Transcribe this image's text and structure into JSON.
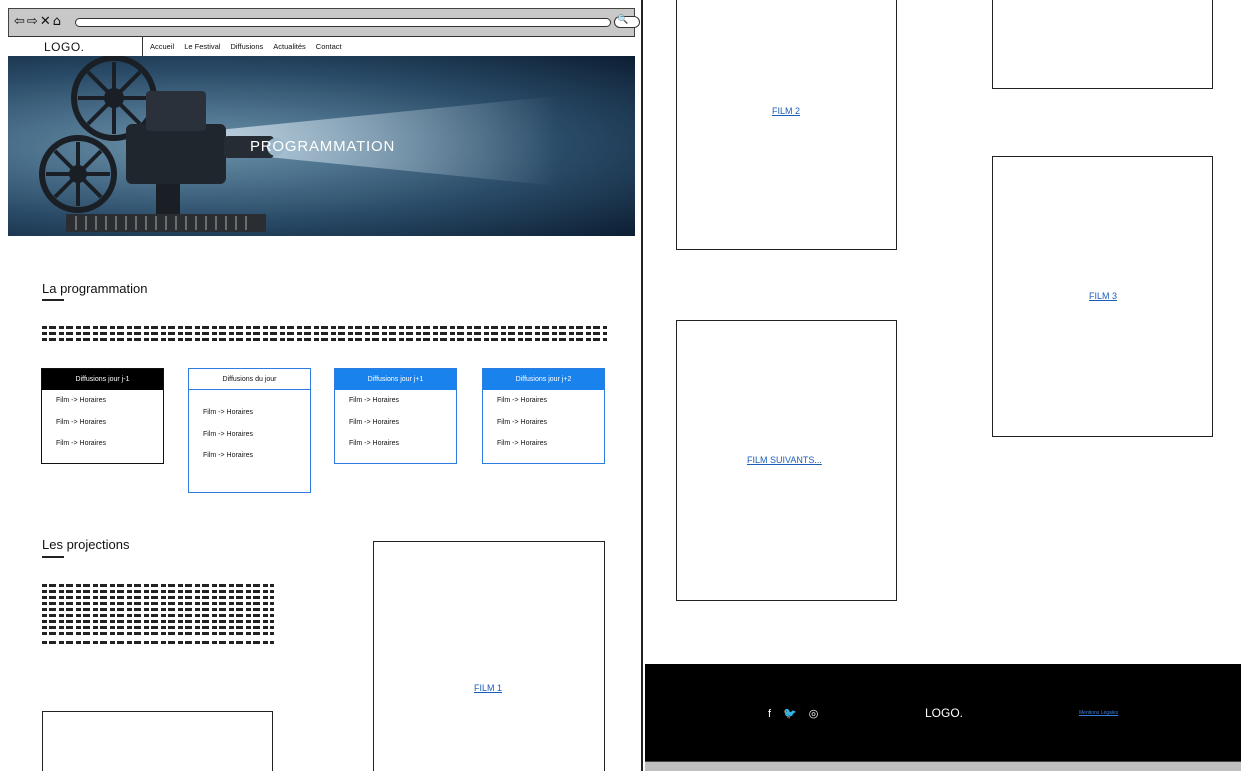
{
  "browser": {
    "nav_icons": [
      "⇦",
      "⇨",
      "✕",
      "⌂"
    ],
    "search_glyph": "🔍"
  },
  "header": {
    "logo": "LOGO.",
    "menu": [
      "Accueil",
      "Le Festival",
      "Diffusions",
      "Actualités",
      "Contact"
    ]
  },
  "hero": {
    "title": "PROGRAMMATION"
  },
  "programmation": {
    "title": "La programmation",
    "boxes": [
      {
        "header": "Diffusions jour j-1",
        "style": "dark",
        "items": [
          "Film -> Horaires",
          "Film -> Horaires",
          "Film -> Horaires"
        ]
      },
      {
        "header": "Diffusions du jour",
        "style": "white",
        "items": [
          "Film -> Horaires",
          "Film -> Horaires",
          "Film -> Horaires"
        ]
      },
      {
        "header": "Diffusions jour j+1",
        "style": "blue",
        "items": [
          "Film -> Horaires",
          "Film -> Horaires",
          "Film -> Horaires"
        ]
      },
      {
        "header": "Diffusions jour j+2",
        "style": "blue",
        "items": [
          "Film -> Horaires",
          "Film -> Horaires",
          "Film -> Horaires"
        ]
      }
    ]
  },
  "projections": {
    "title": "Les projections",
    "film1": "FILM 1"
  },
  "right_panel": {
    "film2": "FILM 2",
    "film3": "FILM 3",
    "film_next": "FILM SUIVANTS..."
  },
  "footer": {
    "social": [
      "f",
      "🐦",
      "◎"
    ],
    "logo": "LOGO.",
    "legal": "Mentions Légales"
  },
  "colors": {
    "accent_blue": "#1a82ec",
    "link_blue": "#1a5db8",
    "dark": "#000000"
  }
}
